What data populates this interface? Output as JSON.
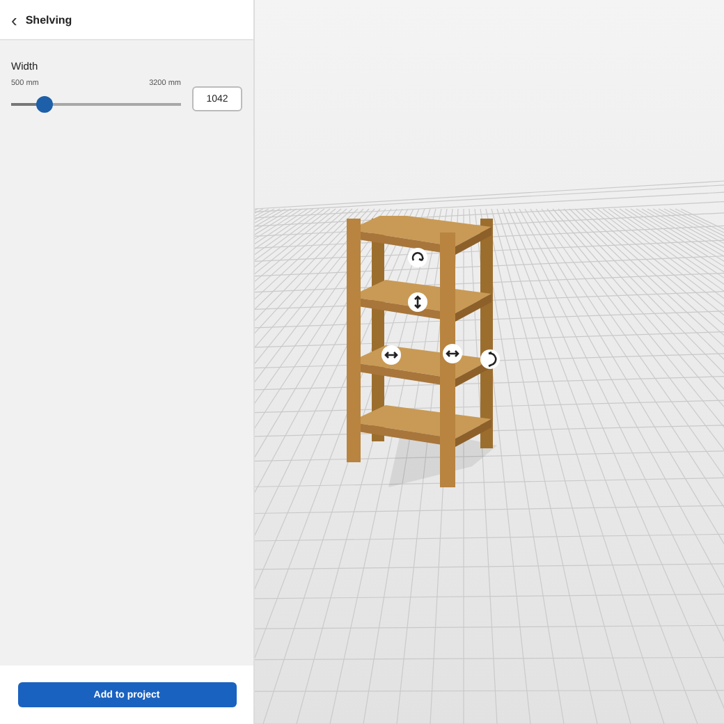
{
  "panel": {
    "back": "‹",
    "title": "Shelving"
  },
  "width_control": {
    "label": "Width",
    "min_label": "500 mm",
    "max_label": "3200 mm",
    "level": 0.2,
    "value": "1042"
  },
  "button": "Add to project"
}
